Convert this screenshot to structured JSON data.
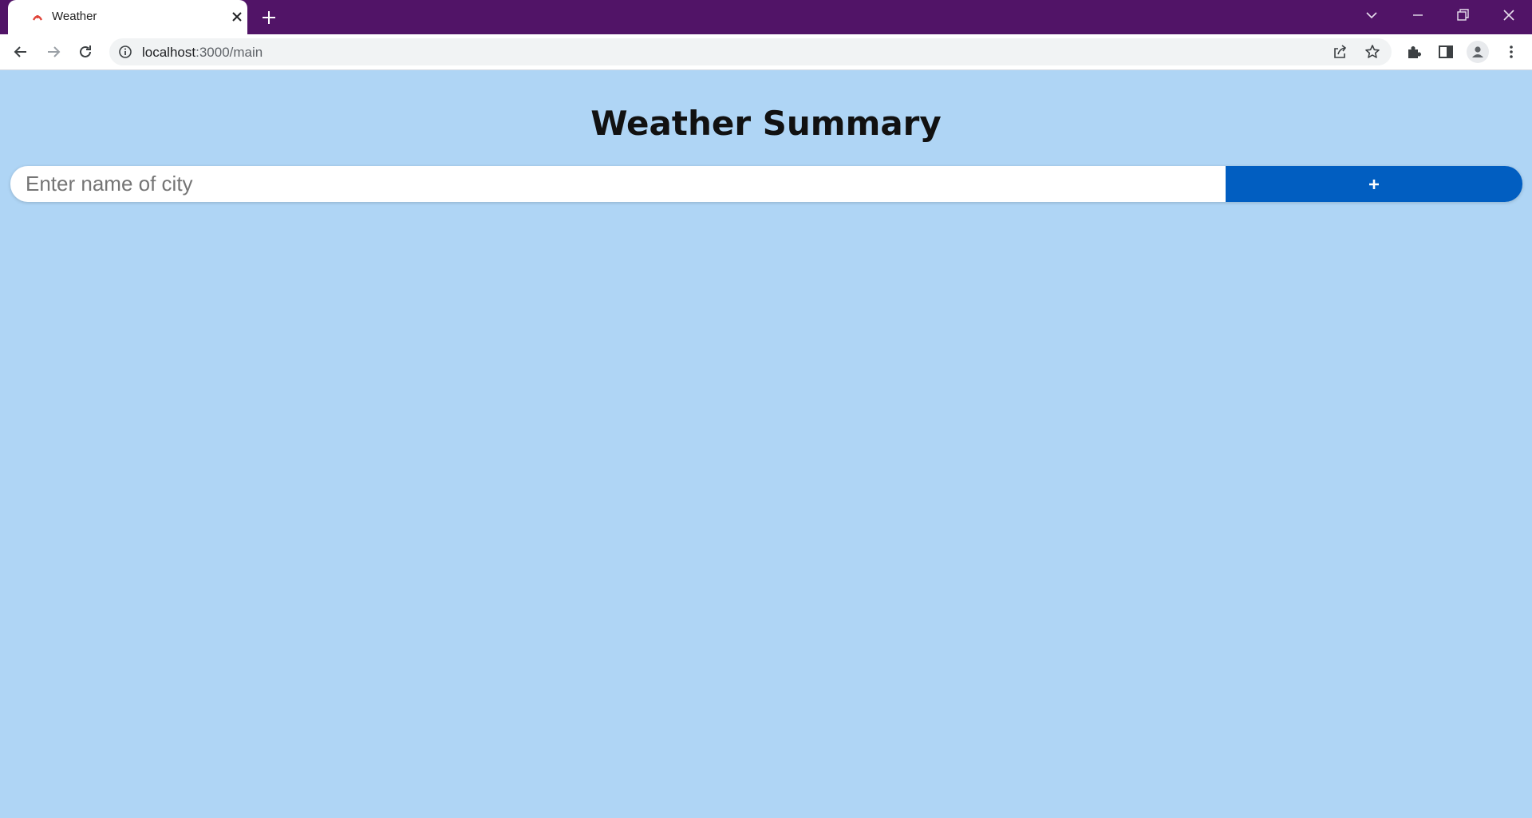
{
  "browser": {
    "tab_title": "Weather",
    "url_host": "localhost",
    "url_path": ":3000/main",
    "colors": {
      "titlebar": "#511467",
      "favicon": "#e0453a"
    },
    "icons": {
      "back": "arrow-left-icon",
      "forward": "arrow-right-icon",
      "reload": "reload-icon",
      "info": "info-icon",
      "share": "share-icon",
      "bookmark": "star-icon",
      "extensions": "puzzle-icon",
      "side_panel": "side-panel-icon",
      "profile": "profile-icon",
      "menu": "kebab-menu-icon"
    }
  },
  "main": {
    "title": "Weather Summary",
    "city_input": {
      "placeholder": "Enter name of city",
      "value": ""
    },
    "add_button": {
      "icon": "plus-icon",
      "color": "#015ec1"
    },
    "background_color": "#afd5f5"
  }
}
